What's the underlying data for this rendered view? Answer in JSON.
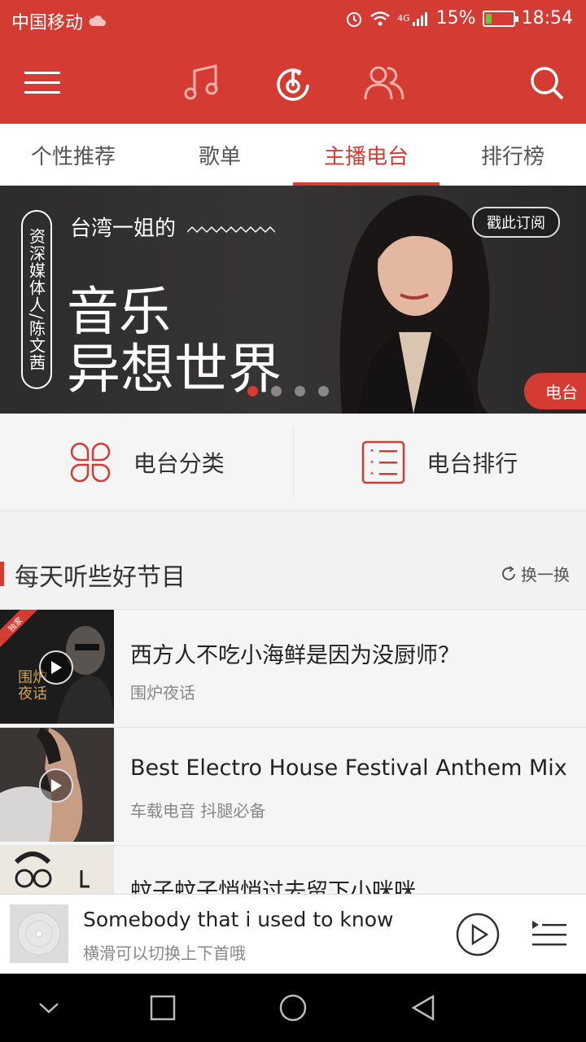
{
  "status_bar": {
    "carrier": "中国移动",
    "network": "4G",
    "battery": "15%",
    "time": "18:54"
  },
  "tabs": [
    {
      "label": "个性推荐"
    },
    {
      "label": "歌单"
    },
    {
      "label": "主播电台"
    },
    {
      "label": "排行榜"
    }
  ],
  "active_tab": "主播电台",
  "banner": {
    "vertical_tag": "资深媒体人/陈文茜",
    "subtitle": "台湾一姐的",
    "title_line1": "音乐",
    "title_line2": "异想世界",
    "subscribe_label": "戳此订阅",
    "badge": "电台",
    "slide_index": 1,
    "slide_count": 4
  },
  "categories": [
    {
      "label": "电台分类",
      "icon": "category-icon"
    },
    {
      "label": "电台排行",
      "icon": "ranking-list-icon"
    }
  ],
  "section": {
    "title": "每天听些好节目",
    "refresh_label": "换一换"
  },
  "programs": [
    {
      "title": "西方人不吃小海鲜是因为没厨师？",
      "subtitle": "围炉夜话",
      "thumb_text": "围炉夜话",
      "badge": "独家"
    },
    {
      "title": "Best Electro House Festival Anthem Mix",
      "subtitle": "车载电音 抖腿必备"
    },
    {
      "title": "蚊子蚊子悄悄过去留下小咪咪",
      "subtitle": ""
    }
  ],
  "player": {
    "song": "Somebody that i used to know",
    "hint": "横滑可以切换上下首哦"
  },
  "colors": {
    "brand": "#d43c33"
  }
}
